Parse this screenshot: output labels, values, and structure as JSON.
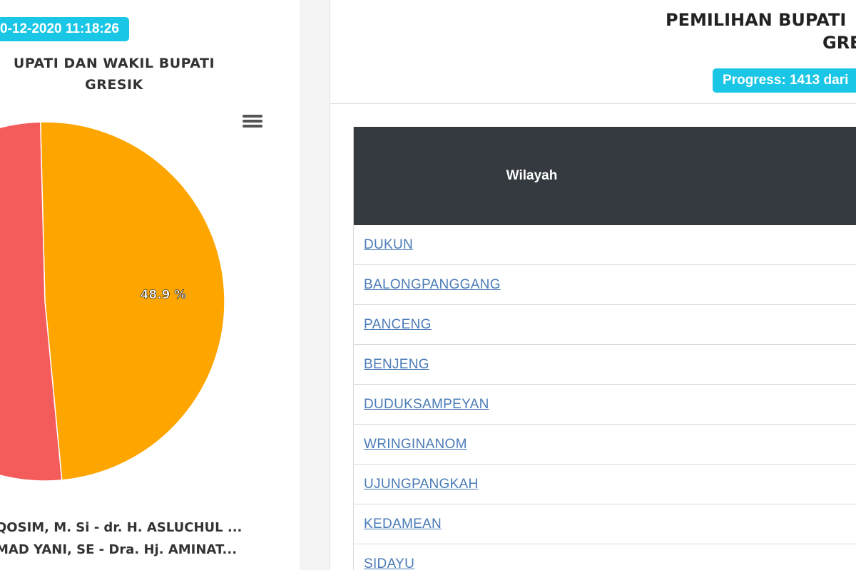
{
  "left": {
    "timestamp": "0-12-2020 11:18:26",
    "chart_title_line1": "UPATI DAN WAKIL BUPATI",
    "chart_title_line2": "GRESIK",
    "menu_icon": "hamburger-menu-icon",
    "legend": [
      "QOSIM, M. Si - dr. H. ASLUCHUL ...",
      "MAD YANI, SE - Dra. Hj. AMINAT..."
    ]
  },
  "chart_data": {
    "type": "pie",
    "slices": [
      {
        "label": "QOSIM, M. Si - dr. H. ASLUCHUL ...",
        "value": 51.1,
        "color": "#f45b5b"
      },
      {
        "label": "MAD YANI, SE - Dra. Hj. AMINAT...",
        "value": 48.9,
        "color": "#ffa500"
      }
    ],
    "data_labels": [
      "",
      "48.9 %"
    ]
  },
  "right": {
    "title_line1": "PEMILIHAN BUPATI",
    "title_line2": "GRE",
    "progress": "Progress: 1413 dari",
    "table": {
      "header": "Wilayah",
      "rows": [
        "DUKUN",
        "BALONGPANGGANG",
        "PANCENG",
        "BENJENG",
        "DUDUKSAMPEYAN",
        "WRINGINANOM",
        "UJUNGPANGKAH",
        "KEDAMEAN",
        "SIDAYU"
      ]
    }
  },
  "colors": {
    "accent": "#19c6e6",
    "table_header_bg": "#343a40",
    "link": "#4a7bb7"
  }
}
